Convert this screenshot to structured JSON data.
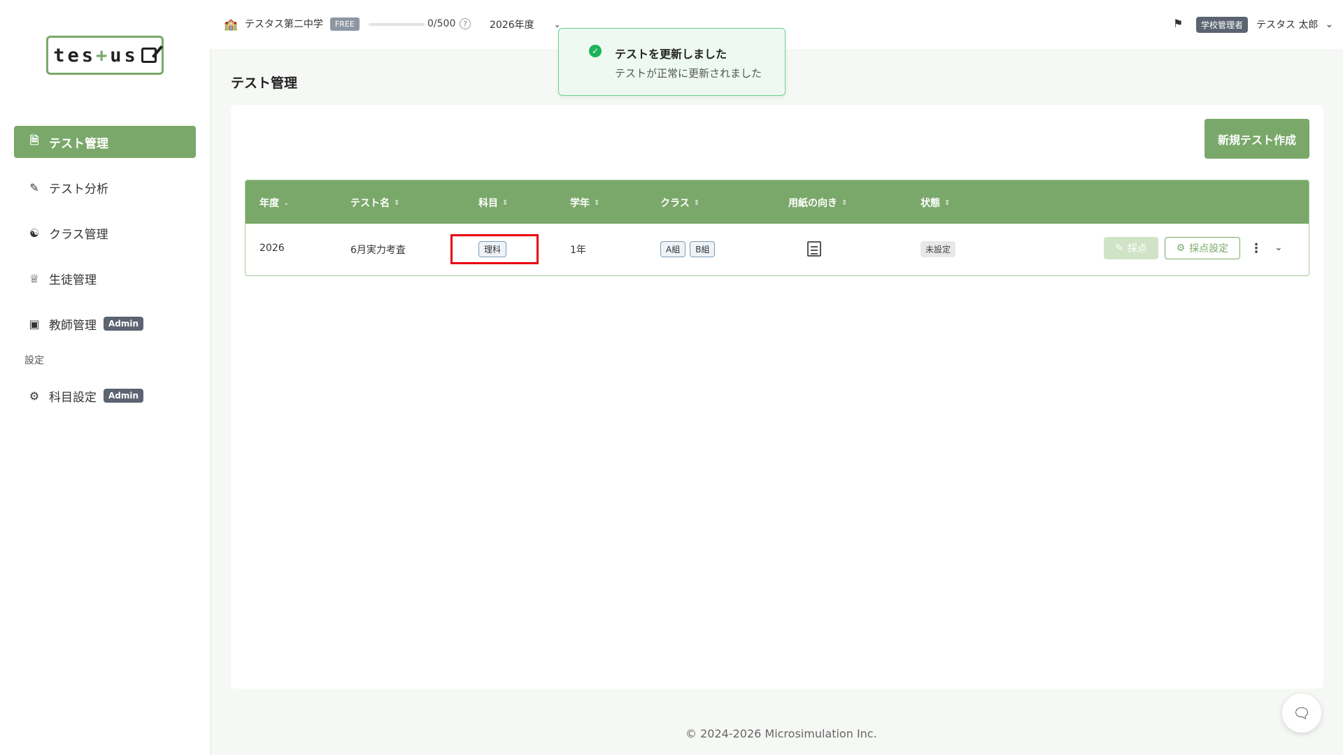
{
  "logo": {
    "text": "tes",
    "plus": "+",
    "text2": "us"
  },
  "sidebar": {
    "items": [
      {
        "label": "テスト管理",
        "icon": "document-icon"
      },
      {
        "label": "テスト分析",
        "icon": "analysis-icon"
      },
      {
        "label": "クラス管理",
        "icon": "users-icon"
      },
      {
        "label": "生徒管理",
        "icon": "student-icon"
      },
      {
        "label": "教師管理",
        "icon": "teacher-icon",
        "badge": "Admin"
      }
    ],
    "section_label": "設定",
    "settings_items": [
      {
        "label": "科目設定",
        "icon": "gear-icon",
        "badge": "Admin"
      }
    ]
  },
  "topbar": {
    "school_name": "テスタス第二中学",
    "plan_badge": "FREE",
    "quota_text": "0/500",
    "quota_fraction": 0,
    "year": "2026年度",
    "role_badge": "学校管理者",
    "user_name": "テスタス 太郎"
  },
  "toast": {
    "title": "テストを更新しました",
    "message": "テストが正常に更新されました"
  },
  "main": {
    "page_title": "テスト管理",
    "new_test_button": "新規テスト作成",
    "table": {
      "headers": [
        "年度",
        "テスト名",
        "科目",
        "学年",
        "クラス",
        "用紙の向き",
        "状態"
      ],
      "rows": [
        {
          "year": "2026",
          "name": "6月実力考査",
          "subject": "理科",
          "grade": "1年",
          "classes": [
            "A組",
            "B組"
          ],
          "status": "未設定",
          "grade_button": "採点",
          "grade_settings_button": "採点設定"
        }
      ]
    }
  },
  "footer": {
    "copyright": "© 2024-2026 Microsimulation Inc."
  }
}
